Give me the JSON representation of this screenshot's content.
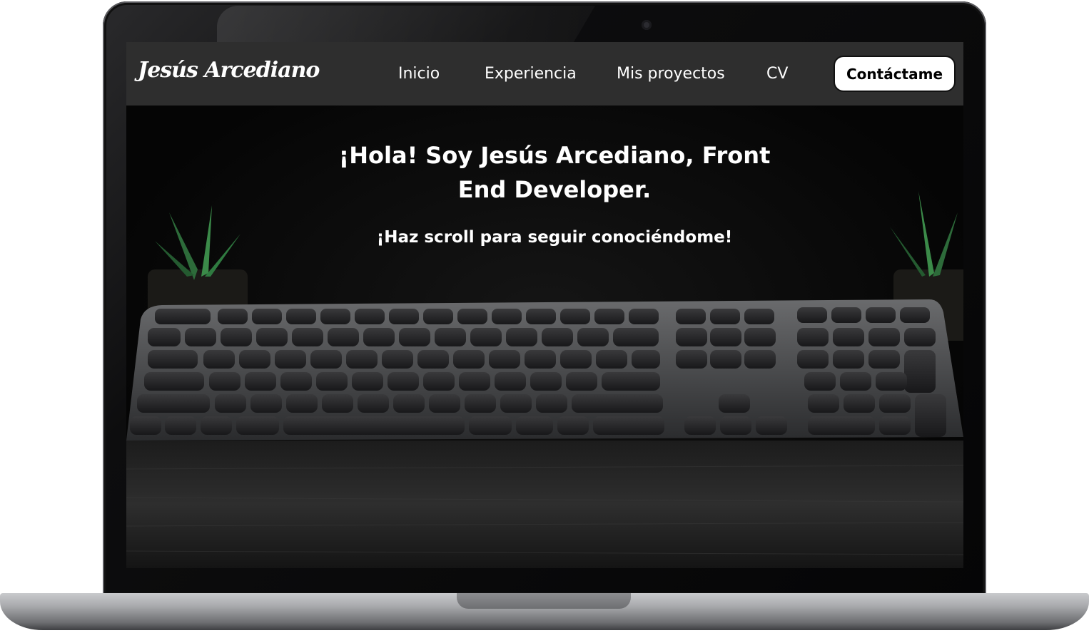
{
  "site": {
    "logo_text": "Jesús Arcediano"
  },
  "nav": {
    "items": [
      {
        "label": "Inicio"
      },
      {
        "label": "Experiencia"
      },
      {
        "label": "Mis proyectos"
      },
      {
        "label": "CV"
      }
    ],
    "contact_label": "Contáctame"
  },
  "hero": {
    "title": "¡Hola! Soy Jesús Arcediano, Front End Developer.",
    "subtitle": "¡Haz scroll para seguir conociéndome!"
  },
  "colors": {
    "navbar_bg": "#2e2e2e",
    "hero_bg": "#0a0a0a",
    "contact_button_bg": "#ffffff",
    "text": "#ffffff"
  },
  "icons": [
    "webcam-icon"
  ]
}
